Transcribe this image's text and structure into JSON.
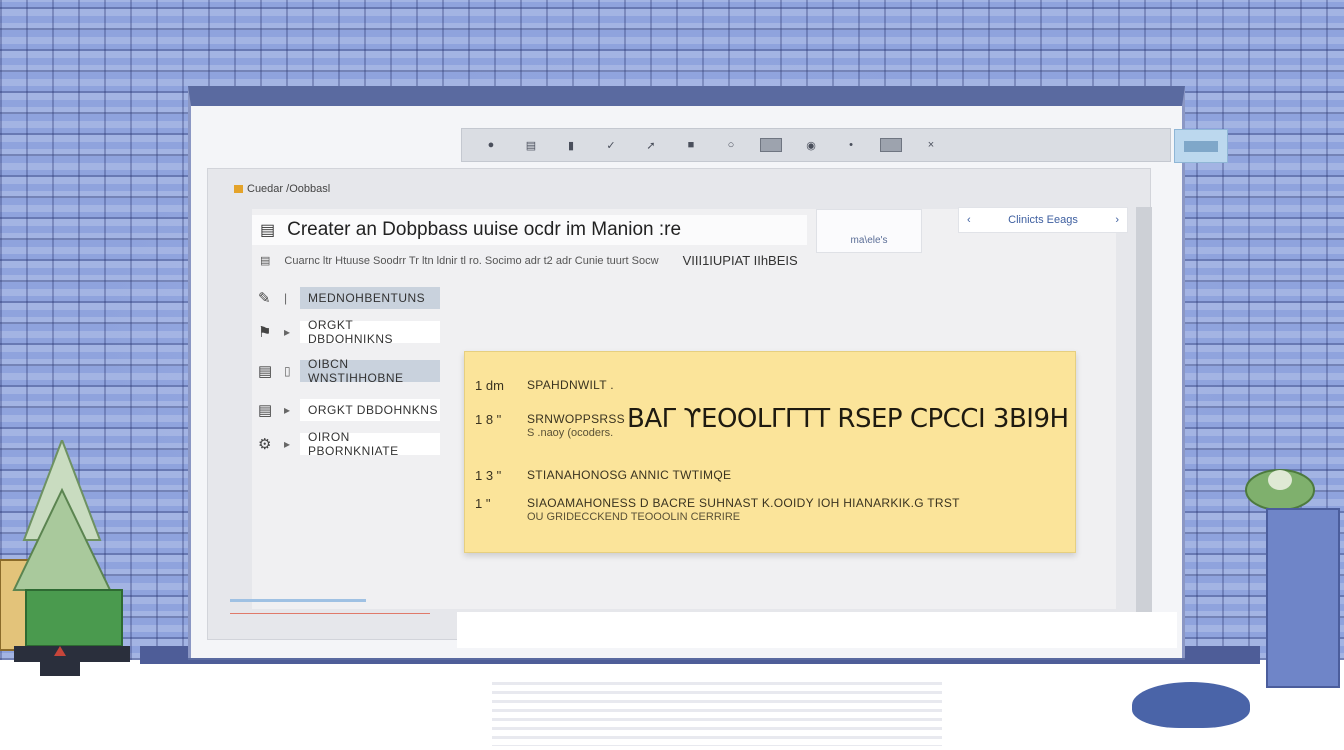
{
  "toolbar": {
    "icons": [
      "pin-icon",
      "text-format-icon",
      "column-icon",
      "pen-icon",
      "cursor-icon",
      "image-icon",
      "circle-icon",
      "screen-icon",
      "record-icon",
      "dot-icon",
      "monitor-icon",
      "close-icon"
    ]
  },
  "document": {
    "tab_label": "Cuedar /Oobbasl",
    "title": "Creater an Dobpbass uuise ocdr im Manion :re",
    "subtitle": "Cuarnc ltr Htuuse Soodrr Tr ltn ldnir tl ro. Socimo adr t2 adr Cunie tuurt Socw",
    "subtitle_tail": "VIII1IUPIAT IIhBEIS",
    "side_panel_label": "ma\\ele's"
  },
  "rows": [
    {
      "icon": "clipboard-icon",
      "sub": "",
      "label": "MEDNOHBENTUNS"
    },
    {
      "icon": "pin-icon",
      "sub": "",
      "label": "ORGKT DBDOHNIKNS"
    },
    {
      "icon": "book-icon",
      "sub": "",
      "label": "OIBCN WNSTIHHOBNE"
    },
    {
      "icon": "page-icon",
      "sub": "",
      "label": "ORGKT DBDOHNKNS"
    },
    {
      "icon": "settings-icon",
      "sub": "",
      "label": "OIRON PBORNKNIATE"
    }
  ],
  "right_search": {
    "label": "Clinicts  Eeags"
  },
  "popup": {
    "items": [
      {
        "num": "1  dm",
        "text": "SPAHDNWILT ."
      },
      {
        "num": "1 8 \"",
        "text": "SRNWOPPSRSS",
        "sub": "S .naoy (ocoders."
      },
      {
        "num": "1 3 \"",
        "text": "STIANAHONOSG ANNIC  TWTIMQE"
      },
      {
        "num": "1 \"",
        "text": "SIAOAMAHONESS D BACRE SUHNAST K.OOIDY IOH HIANARKIK.G TRST",
        "sub": "OU GRIDECCKEND TEOOOLIN CERRIRE"
      }
    ],
    "banner": "BAΓ ϒEOOLΓΓTΤ RSEP CPCCI 3BI9H"
  }
}
